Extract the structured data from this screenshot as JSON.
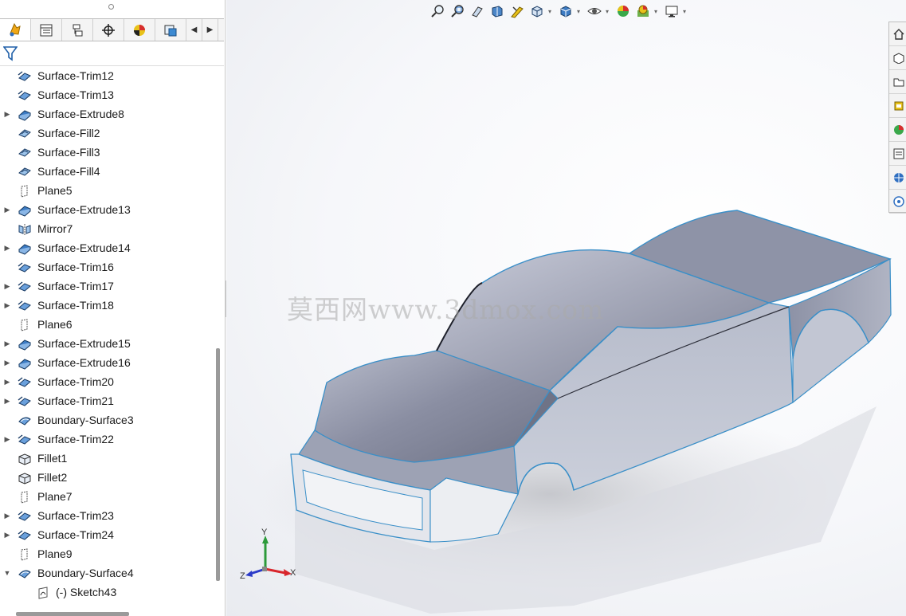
{
  "feature_tree": {
    "items": [
      {
        "label": "Surface-Trim12",
        "icon": "surface-trim-icon",
        "expandable": false
      },
      {
        "label": "Surface-Trim13",
        "icon": "surface-trim-icon",
        "expandable": false
      },
      {
        "label": "Surface-Extrude8",
        "icon": "surface-extrude-icon",
        "expandable": true
      },
      {
        "label": "Surface-Fill2",
        "icon": "surface-fill-icon",
        "expandable": false
      },
      {
        "label": "Surface-Fill3",
        "icon": "surface-fill-icon",
        "expandable": false
      },
      {
        "label": "Surface-Fill4",
        "icon": "surface-fill-icon",
        "expandable": false
      },
      {
        "label": "Plane5",
        "icon": "plane-icon",
        "expandable": false
      },
      {
        "label": "Surface-Extrude13",
        "icon": "surface-extrude-icon",
        "expandable": true
      },
      {
        "label": "Mirror7",
        "icon": "mirror-icon",
        "expandable": false
      },
      {
        "label": "Surface-Extrude14",
        "icon": "surface-extrude-icon",
        "expandable": true
      },
      {
        "label": "Surface-Trim16",
        "icon": "surface-trim-icon",
        "expandable": false
      },
      {
        "label": "Surface-Trim17",
        "icon": "surface-trim-icon",
        "expandable": true
      },
      {
        "label": "Surface-Trim18",
        "icon": "surface-trim-icon",
        "expandable": true
      },
      {
        "label": "Plane6",
        "icon": "plane-icon",
        "expandable": false
      },
      {
        "label": "Surface-Extrude15",
        "icon": "surface-extrude-icon",
        "expandable": true
      },
      {
        "label": "Surface-Extrude16",
        "icon": "surface-extrude-icon",
        "expandable": true
      },
      {
        "label": "Surface-Trim20",
        "icon": "surface-trim-icon",
        "expandable": true
      },
      {
        "label": "Surface-Trim21",
        "icon": "surface-trim-icon",
        "expandable": true
      },
      {
        "label": "Boundary-Surface3",
        "icon": "boundary-surface-icon",
        "expandable": false
      },
      {
        "label": "Surface-Trim22",
        "icon": "surface-trim-icon",
        "expandable": true
      },
      {
        "label": "Fillet1",
        "icon": "fillet-icon",
        "expandable": false
      },
      {
        "label": "Fillet2",
        "icon": "fillet-icon",
        "expandable": false
      },
      {
        "label": "Plane7",
        "icon": "plane-icon",
        "expandable": false
      },
      {
        "label": "Surface-Trim23",
        "icon": "surface-trim-icon",
        "expandable": true
      },
      {
        "label": "Surface-Trim24",
        "icon": "surface-trim-icon",
        "expandable": true
      },
      {
        "label": "Plane9",
        "icon": "plane-icon",
        "expandable": false
      },
      {
        "label": "Boundary-Surface4",
        "icon": "boundary-surface-icon",
        "expandable": true,
        "expanded": true
      },
      {
        "label": "(-) Sketch43",
        "icon": "sketch-icon",
        "expandable": false,
        "child": true
      }
    ]
  },
  "watermark": {
    "text": "莫西网www.3dmox.com"
  },
  "triad": {
    "x": "X",
    "y": "Y",
    "z": "Z"
  },
  "colors": {
    "model_edge": "#3a8fc8",
    "model_face": "#a3a8bb",
    "axis_x": "#d8262c",
    "axis_y": "#2c9a3a",
    "axis_z": "#2b3bc9"
  }
}
